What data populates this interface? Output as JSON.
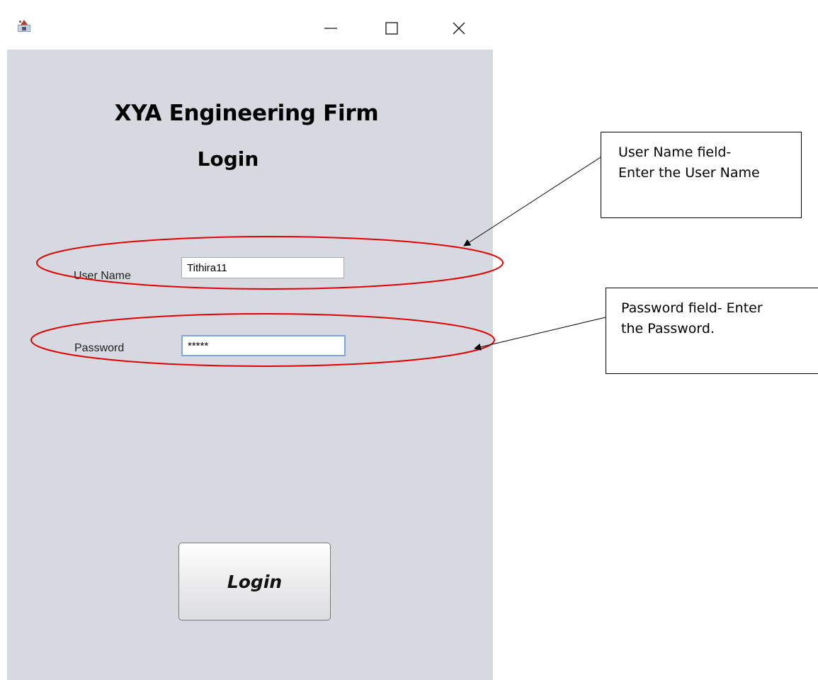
{
  "window": {
    "controls": {
      "minimize": "minimize-icon",
      "maximize": "maximize-icon",
      "close": "close-icon"
    }
  },
  "form": {
    "heading": "XYA Engineering Firm",
    "subheading": "Login",
    "username_label": "User Name",
    "username_value": "Tithira11",
    "password_label": "Password",
    "password_value": "*****",
    "login_button": "Login"
  },
  "annotations": {
    "username_callout": [
      "User Name field-",
      "Enter the User Name"
    ],
    "password_callout": [
      "Password field- Enter",
      "the Password."
    ],
    "highlight_color": "#e00000"
  }
}
